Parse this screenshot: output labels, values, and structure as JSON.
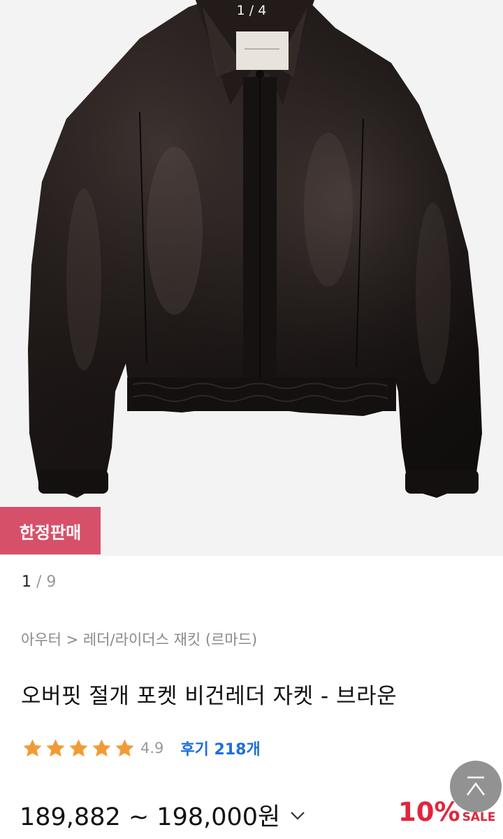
{
  "gallery": {
    "counter": "1 / 4",
    "badge": "한정판매",
    "image_index": "1",
    "image_separator": " / ",
    "image_total": "9"
  },
  "product": {
    "breadcrumb": "아우터 > 레더/라이더스 재킷 (르마드)",
    "title": "오버핏 절개 포켓 비건레더 자켓 - 브라운",
    "rating": "4.9",
    "rating_stars": 5,
    "reviews": "후기 218개",
    "price_range": "189,882 ~ 198,000원",
    "discount_percent": "10%",
    "discount_label": "SALE"
  },
  "colors": {
    "badge": "#d6506a",
    "star": "#f29b36",
    "review_link": "#1e6fd6",
    "discount": "#e0263c"
  },
  "icons": {
    "chevron": "chevron-down-icon",
    "scroll": "scroll-to-top-icon",
    "star": "star-icon"
  }
}
